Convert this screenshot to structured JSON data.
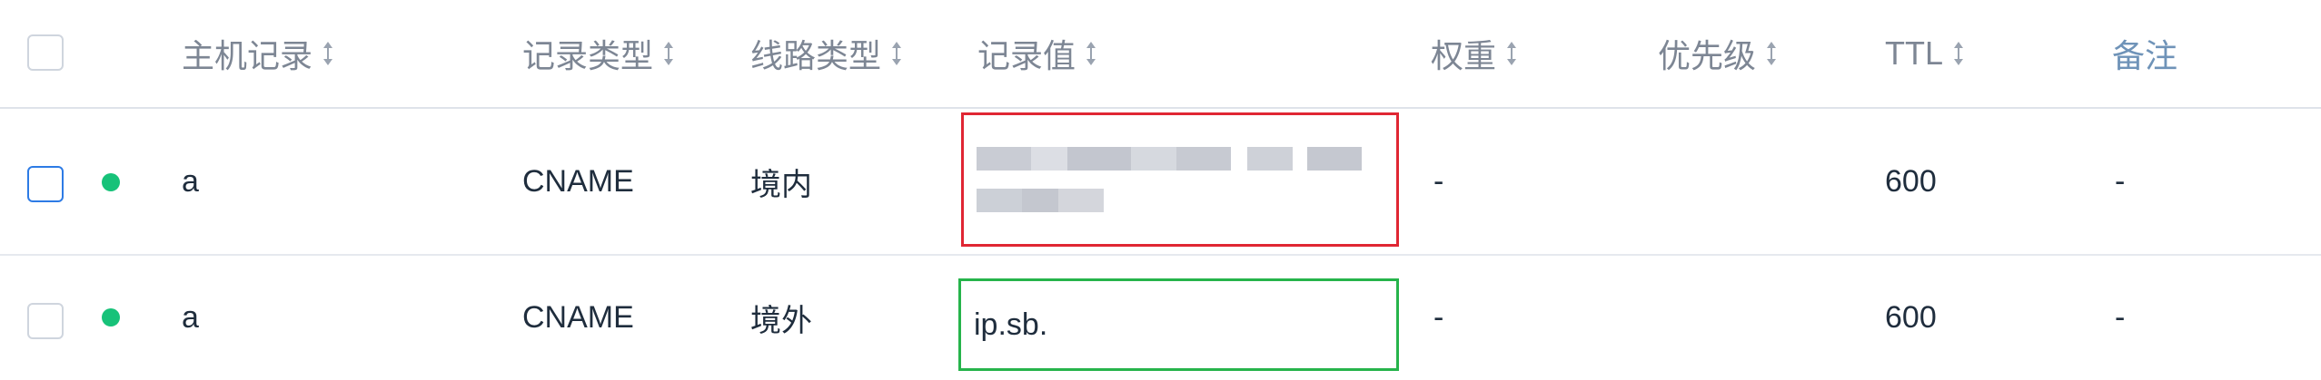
{
  "header": {
    "host": "主机记录",
    "type": "记录类型",
    "line": "线路类型",
    "value": "记录值",
    "weight": "权重",
    "priority": "优先级",
    "ttl": "TTL",
    "note": "备注"
  },
  "rows": [
    {
      "host": "a",
      "type": "CNAME",
      "line": "境内",
      "value": "",
      "value_redacted": true,
      "weight": "-",
      "ttl": "600",
      "note": "-",
      "status_color": "#17c279",
      "highlight_color": "#e02633"
    },
    {
      "host": "a",
      "type": "CNAME",
      "line": "境外",
      "value": "ip.sb.",
      "value_redacted": false,
      "weight": "-",
      "ttl": "600",
      "note": "-",
      "status_color": "#17c279",
      "highlight_color": "#26b44b"
    }
  ],
  "icons": {
    "sort": "sort-updown-icon",
    "checkbox": "checkbox-icon",
    "status": "status-dot-icon"
  }
}
